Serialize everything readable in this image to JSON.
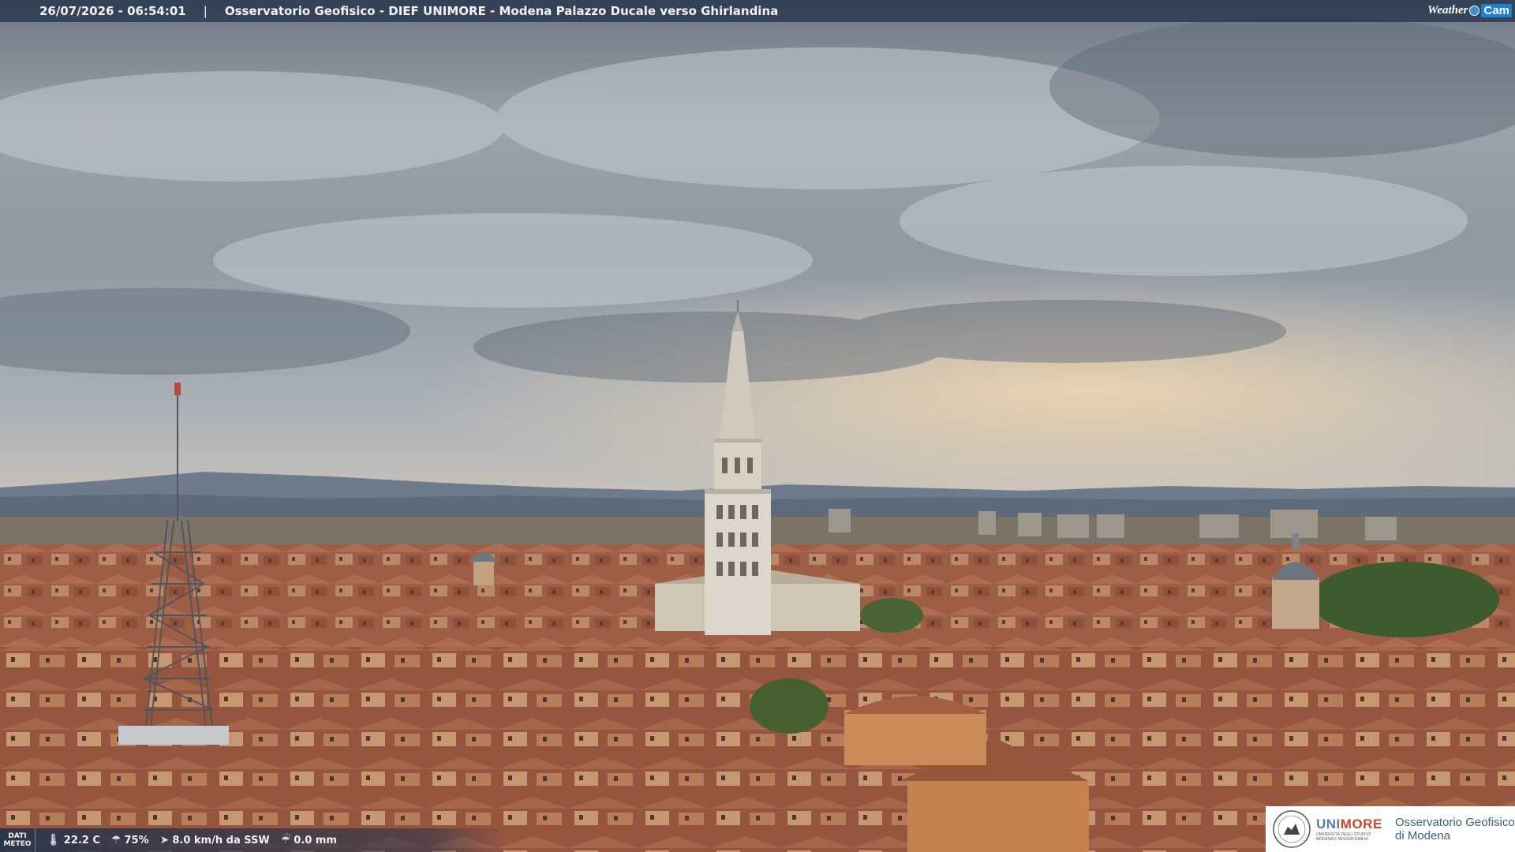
{
  "header": {
    "timestamp": "26/07/2026 - 06:54:01",
    "separator": "|",
    "title": "Osservatorio Geofisico - DIEF UNIMORE - Modena Palazzo Ducale verso Ghirlandina",
    "logo": {
      "left": "Weather",
      "right": "Cam"
    }
  },
  "weather": {
    "label_top": "DATI",
    "label_bottom": "METEO",
    "temperature": "22.2 C",
    "humidity": "75%",
    "wind": "8.0 km/h da SSW",
    "rain": "0.0 mm",
    "icons": [
      "thermometer-icon",
      "humidity-drop-icon",
      "wind-icon",
      "rain-gauge-icon"
    ]
  },
  "branding": {
    "university": "UNIMORE",
    "university_highlight": "MORE",
    "university_prefix": "UNI",
    "university_sub": "UNIVERSITÀ DEGLI STUDI DI MODENA E REGGIO EMILIA",
    "observatory_line1": "Osservatorio Geofisico",
    "observatory_line2": "di Modena"
  },
  "colors": {
    "sky_top": "#6d7885",
    "sky_mid": "#a4acb4",
    "horizon_glow": "#efd5b2",
    "mountains": "#6f7d8c",
    "roofs": "#a4644a",
    "tower": "#d8d2c6",
    "accent_blue": "#1f7fd0"
  }
}
